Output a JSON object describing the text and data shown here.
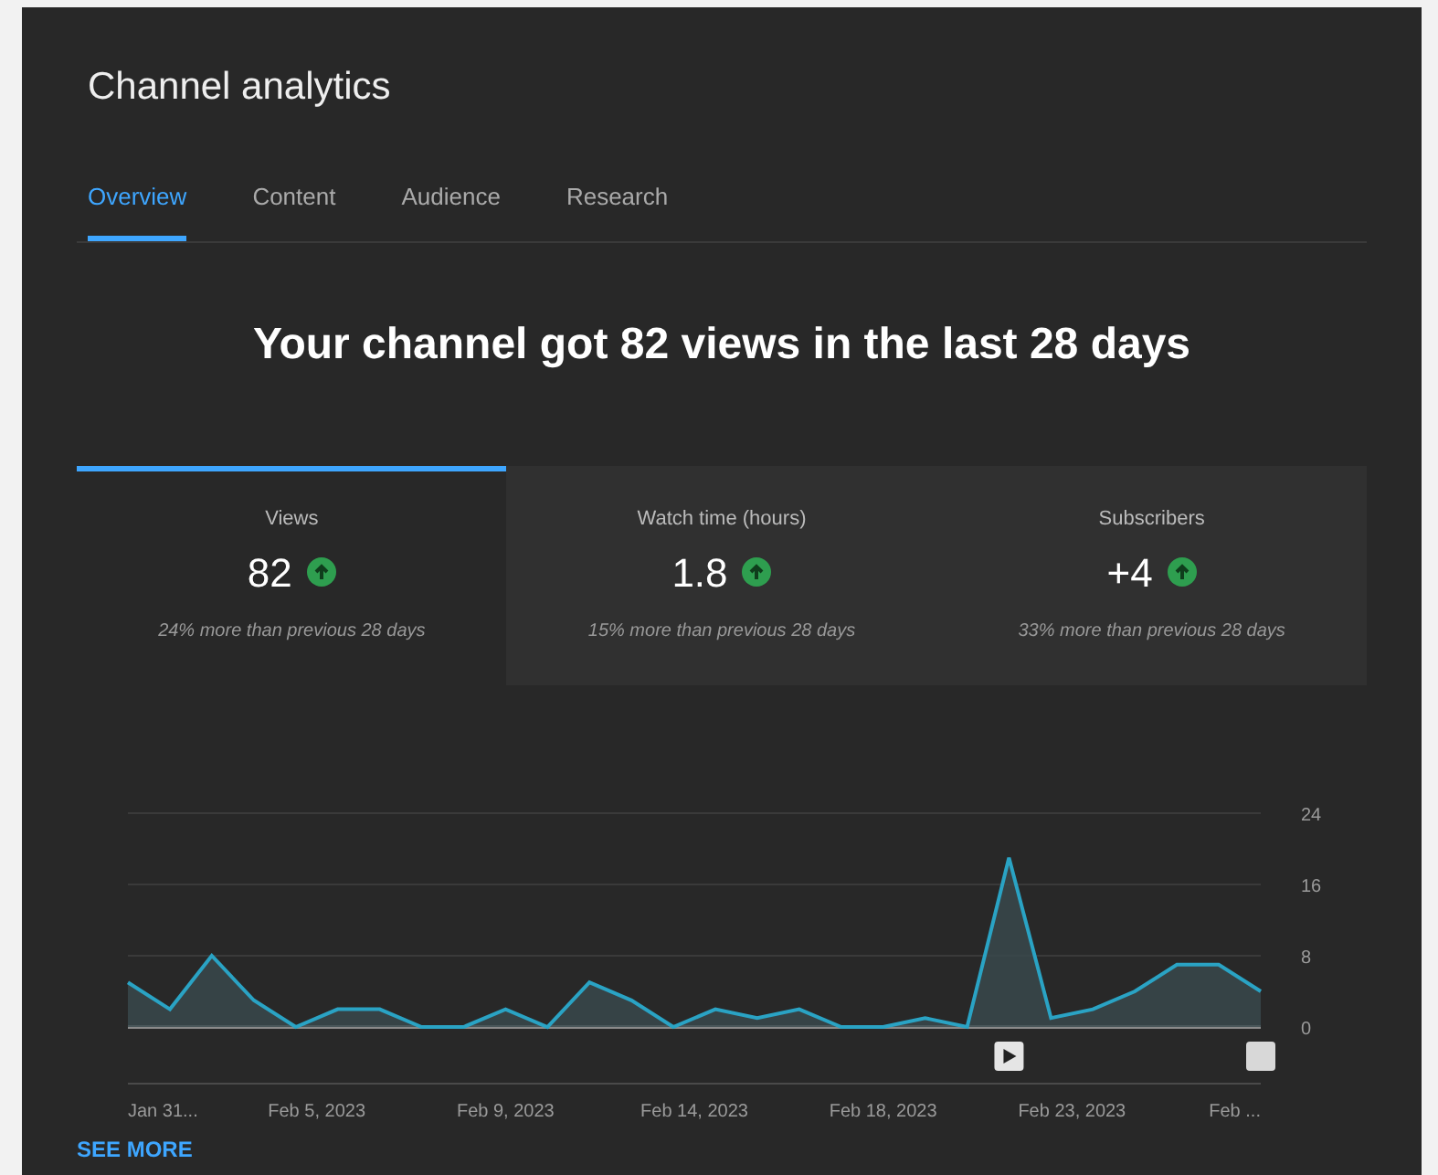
{
  "title": "Channel analytics",
  "tabs": [
    {
      "label": "Overview",
      "selected": true
    },
    {
      "label": "Content",
      "selected": false
    },
    {
      "label": "Audience",
      "selected": false
    },
    {
      "label": "Research",
      "selected": false
    }
  ],
  "headline": "Your channel got 82 views in the last 28 days",
  "metrics": [
    {
      "label": "Views",
      "value": "82",
      "note": "24% more than previous 28 days",
      "selected": true
    },
    {
      "label": "Watch time (hours)",
      "value": "1.8",
      "note": "15% more than previous 28 days",
      "selected": false
    },
    {
      "label": "Subscribers",
      "value": "+4",
      "note": "33% more than previous 28 days",
      "selected": false
    }
  ],
  "chart_data": {
    "type": "area",
    "series": [
      {
        "color": "#2aa3c4",
        "values": [
          5,
          2,
          8,
          3,
          0,
          2,
          2,
          0,
          0,
          2,
          0,
          5,
          3,
          0,
          2,
          1,
          2,
          0,
          0,
          1,
          0,
          19,
          1,
          2,
          4,
          7,
          7,
          4
        ]
      }
    ],
    "ylim": [
      0,
      24
    ],
    "yticks": [
      0,
      8,
      16,
      24
    ]
  },
  "date_labels": [
    "Jan 31...",
    "Feb 5, 2023",
    "Feb 9, 2023",
    "Feb 14, 2023",
    "Feb 18, 2023",
    "Feb 23, 2023",
    "Feb ..."
  ],
  "see_more": "SEE MORE"
}
